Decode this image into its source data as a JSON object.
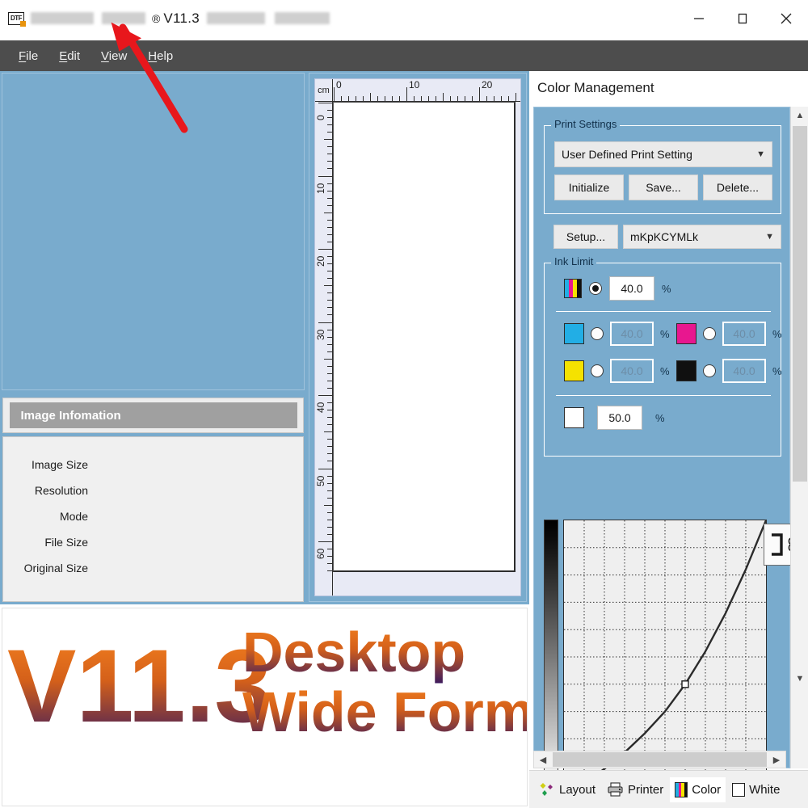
{
  "window": {
    "title_version": "V11.3",
    "title_registered_mark": "®",
    "title_redacted_left": "redacted-app-name",
    "title_redacted_right": "redacted-edition-text",
    "app_icon_glyph": "DTF",
    "controls": {
      "minimize": "minimize-button",
      "maximize": "maximize-button",
      "close": "close-button"
    }
  },
  "menubar": {
    "items": [
      {
        "label": "File",
        "mnemonic": "F"
      },
      {
        "label": "Edit",
        "mnemonic": "E"
      },
      {
        "label": "View",
        "mnemonic": "V"
      },
      {
        "label": "Help",
        "mnemonic": "H"
      }
    ]
  },
  "image_information": {
    "header": "Image Infomation",
    "rows": [
      {
        "label": "Image Size",
        "value": ""
      },
      {
        "label": "Resolution",
        "value": ""
      },
      {
        "label": "Mode",
        "value": ""
      },
      {
        "label": "File Size",
        "value": ""
      },
      {
        "label": "Original Size",
        "value": ""
      }
    ]
  },
  "ruler": {
    "unit": "cm",
    "horizontal_labels": [
      "0",
      "10",
      "20"
    ],
    "vertical_labels": [
      "0",
      "10",
      "20",
      "30",
      "40",
      "50",
      "60"
    ]
  },
  "color_management": {
    "panel_title": "Color Management",
    "print_settings": {
      "legend": "Print Settings",
      "preset_value": "User Defined Print Setting",
      "buttons": {
        "initialize": "Initialize",
        "save": "Save...",
        "delete": "Delete..."
      }
    },
    "ink_setup": {
      "setup_button": "Setup...",
      "ink_set_value": "mKpKCYMLk"
    },
    "ink_limit": {
      "legend": "Ink Limit",
      "percent_symbol": "%",
      "composite": {
        "swatch": "cmyk-composite-swatch",
        "selected": true,
        "value": "40.0"
      },
      "channels": [
        {
          "name": "cyan",
          "color": "#22aee5",
          "value": "40.0",
          "selected": false,
          "enabled": false
        },
        {
          "name": "magenta",
          "color": "#e8178f",
          "value": "40.0",
          "selected": false,
          "enabled": false
        },
        {
          "name": "yellow",
          "color": "#f5e200",
          "value": "40.0",
          "selected": false,
          "enabled": false
        },
        {
          "name": "black",
          "color": "#101010",
          "value": "40.0",
          "selected": false,
          "enabled": false
        }
      ],
      "white_channel": {
        "name": "white",
        "color": "#ffffff",
        "value": "50.0"
      }
    },
    "curve": {
      "link_button": "link-curve-button",
      "gradient_top": "#000000",
      "gradient_bottom": "#ffffff"
    }
  },
  "chart_data": {
    "type": "line",
    "title": "",
    "xlabel": "",
    "ylabel": "",
    "xlim": [
      0,
      100
    ],
    "ylim": [
      0,
      100
    ],
    "grid": true,
    "legend": null,
    "series": [
      {
        "name": "tone-curve",
        "x": [
          0,
          10,
          20,
          30,
          40,
          50,
          60,
          70,
          80,
          90,
          100
        ],
        "y": [
          0,
          4,
          9,
          15,
          22,
          30,
          40,
          52,
          66,
          82,
          100
        ]
      }
    ],
    "control_points": [
      {
        "x": 60,
        "y": 40
      }
    ]
  },
  "tabs": [
    {
      "id": "layout",
      "label": "Layout",
      "icon": "diamonds-icon",
      "active": false
    },
    {
      "id": "printer",
      "label": "Printer",
      "icon": "printer-icon",
      "active": false
    },
    {
      "id": "color",
      "label": "Color",
      "icon": "cmyk-bars-icon",
      "active": true
    },
    {
      "id": "white",
      "label": "White",
      "icon": "white-square-icon",
      "active": false
    }
  ],
  "banner": {
    "version": "V11.3",
    "line1": "Desktop",
    "line2": "Wide Format",
    "gradient_start": "#f5821f",
    "gradient_end": "#3b1a5e"
  },
  "annotation": {
    "arrow": "red-arrow-pointing-to-version",
    "color": "#e8171c"
  },
  "palette": {
    "workspace_blue": "#79abcd",
    "menubar_gray": "#4d4d4d",
    "panel_gray": "#f0f0f0"
  }
}
